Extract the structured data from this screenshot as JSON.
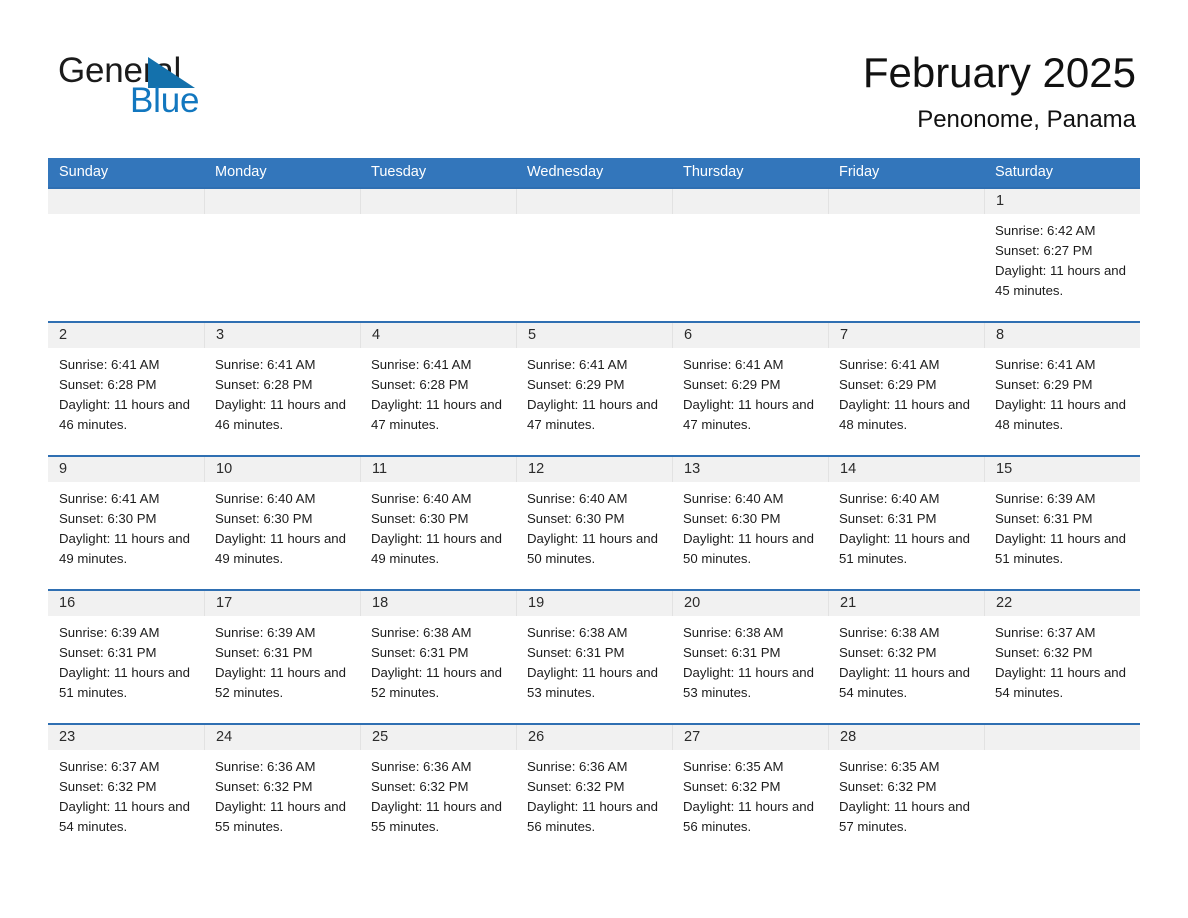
{
  "brand": {
    "name_part1": "General",
    "name_part2": "Blue",
    "triangle_color": "#1471ac",
    "blue_text_color": "#1277bf"
  },
  "header": {
    "title": "February 2025",
    "subtitle": "Penonome, Panama"
  },
  "theme": {
    "header_row_bg": "#3376bb",
    "row_border": "#2f6fb2",
    "daynum_band_bg": "#f1f1f1"
  },
  "weekdays": [
    "Sunday",
    "Monday",
    "Tuesday",
    "Wednesday",
    "Thursday",
    "Friday",
    "Saturday"
  ],
  "weeks": [
    [
      {
        "empty": true
      },
      {
        "empty": true
      },
      {
        "empty": true
      },
      {
        "empty": true
      },
      {
        "empty": true
      },
      {
        "empty": true
      },
      {
        "day": "1",
        "sunrise": "Sunrise: 6:42 AM",
        "sunset": "Sunset: 6:27 PM",
        "daylight": "Daylight: 11 hours and 45 minutes."
      }
    ],
    [
      {
        "day": "2",
        "sunrise": "Sunrise: 6:41 AM",
        "sunset": "Sunset: 6:28 PM",
        "daylight": "Daylight: 11 hours and 46 minutes."
      },
      {
        "day": "3",
        "sunrise": "Sunrise: 6:41 AM",
        "sunset": "Sunset: 6:28 PM",
        "daylight": "Daylight: 11 hours and 46 minutes."
      },
      {
        "day": "4",
        "sunrise": "Sunrise: 6:41 AM",
        "sunset": "Sunset: 6:28 PM",
        "daylight": "Daylight: 11 hours and 47 minutes."
      },
      {
        "day": "5",
        "sunrise": "Sunrise: 6:41 AM",
        "sunset": "Sunset: 6:29 PM",
        "daylight": "Daylight: 11 hours and 47 minutes."
      },
      {
        "day": "6",
        "sunrise": "Sunrise: 6:41 AM",
        "sunset": "Sunset: 6:29 PM",
        "daylight": "Daylight: 11 hours and 47 minutes."
      },
      {
        "day": "7",
        "sunrise": "Sunrise: 6:41 AM",
        "sunset": "Sunset: 6:29 PM",
        "daylight": "Daylight: 11 hours and 48 minutes."
      },
      {
        "day": "8",
        "sunrise": "Sunrise: 6:41 AM",
        "sunset": "Sunset: 6:29 PM",
        "daylight": "Daylight: 11 hours and 48 minutes."
      }
    ],
    [
      {
        "day": "9",
        "sunrise": "Sunrise: 6:41 AM",
        "sunset": "Sunset: 6:30 PM",
        "daylight": "Daylight: 11 hours and 49 minutes."
      },
      {
        "day": "10",
        "sunrise": "Sunrise: 6:40 AM",
        "sunset": "Sunset: 6:30 PM",
        "daylight": "Daylight: 11 hours and 49 minutes."
      },
      {
        "day": "11",
        "sunrise": "Sunrise: 6:40 AM",
        "sunset": "Sunset: 6:30 PM",
        "daylight": "Daylight: 11 hours and 49 minutes."
      },
      {
        "day": "12",
        "sunrise": "Sunrise: 6:40 AM",
        "sunset": "Sunset: 6:30 PM",
        "daylight": "Daylight: 11 hours and 50 minutes."
      },
      {
        "day": "13",
        "sunrise": "Sunrise: 6:40 AM",
        "sunset": "Sunset: 6:30 PM",
        "daylight": "Daylight: 11 hours and 50 minutes."
      },
      {
        "day": "14",
        "sunrise": "Sunrise: 6:40 AM",
        "sunset": "Sunset: 6:31 PM",
        "daylight": "Daylight: 11 hours and 51 minutes."
      },
      {
        "day": "15",
        "sunrise": "Sunrise: 6:39 AM",
        "sunset": "Sunset: 6:31 PM",
        "daylight": "Daylight: 11 hours and 51 minutes."
      }
    ],
    [
      {
        "day": "16",
        "sunrise": "Sunrise: 6:39 AM",
        "sunset": "Sunset: 6:31 PM",
        "daylight": "Daylight: 11 hours and 51 minutes."
      },
      {
        "day": "17",
        "sunrise": "Sunrise: 6:39 AM",
        "sunset": "Sunset: 6:31 PM",
        "daylight": "Daylight: 11 hours and 52 minutes."
      },
      {
        "day": "18",
        "sunrise": "Sunrise: 6:38 AM",
        "sunset": "Sunset: 6:31 PM",
        "daylight": "Daylight: 11 hours and 52 minutes."
      },
      {
        "day": "19",
        "sunrise": "Sunrise: 6:38 AM",
        "sunset": "Sunset: 6:31 PM",
        "daylight": "Daylight: 11 hours and 53 minutes."
      },
      {
        "day": "20",
        "sunrise": "Sunrise: 6:38 AM",
        "sunset": "Sunset: 6:31 PM",
        "daylight": "Daylight: 11 hours and 53 minutes."
      },
      {
        "day": "21",
        "sunrise": "Sunrise: 6:38 AM",
        "sunset": "Sunset: 6:32 PM",
        "daylight": "Daylight: 11 hours and 54 minutes."
      },
      {
        "day": "22",
        "sunrise": "Sunrise: 6:37 AM",
        "sunset": "Sunset: 6:32 PM",
        "daylight": "Daylight: 11 hours and 54 minutes."
      }
    ],
    [
      {
        "day": "23",
        "sunrise": "Sunrise: 6:37 AM",
        "sunset": "Sunset: 6:32 PM",
        "daylight": "Daylight: 11 hours and 54 minutes."
      },
      {
        "day": "24",
        "sunrise": "Sunrise: 6:36 AM",
        "sunset": "Sunset: 6:32 PM",
        "daylight": "Daylight: 11 hours and 55 minutes."
      },
      {
        "day": "25",
        "sunrise": "Sunrise: 6:36 AM",
        "sunset": "Sunset: 6:32 PM",
        "daylight": "Daylight: 11 hours and 55 minutes."
      },
      {
        "day": "26",
        "sunrise": "Sunrise: 6:36 AM",
        "sunset": "Sunset: 6:32 PM",
        "daylight": "Daylight: 11 hours and 56 minutes."
      },
      {
        "day": "27",
        "sunrise": "Sunrise: 6:35 AM",
        "sunset": "Sunset: 6:32 PM",
        "daylight": "Daylight: 11 hours and 56 minutes."
      },
      {
        "day": "28",
        "sunrise": "Sunrise: 6:35 AM",
        "sunset": "Sunset: 6:32 PM",
        "daylight": "Daylight: 11 hours and 57 minutes."
      },
      {
        "empty": true
      }
    ]
  ]
}
